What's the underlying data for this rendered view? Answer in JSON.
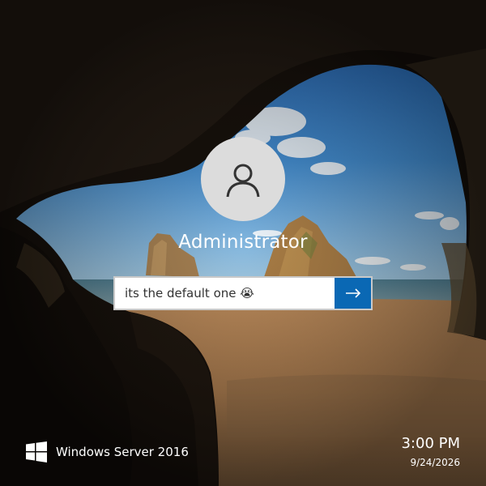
{
  "user": {
    "name": "Administrator",
    "avatar_icon": "user-silhouette-icon"
  },
  "login": {
    "password_value": "its the default one 😭",
    "submit_icon": "arrow-right-icon",
    "accent": "#0a68b4"
  },
  "brand": {
    "name": "Windows Server 2016",
    "logo_icon": "windows-logo-icon"
  },
  "clock": {
    "time": "3:00 PM",
    "date": "9/24/2026"
  }
}
